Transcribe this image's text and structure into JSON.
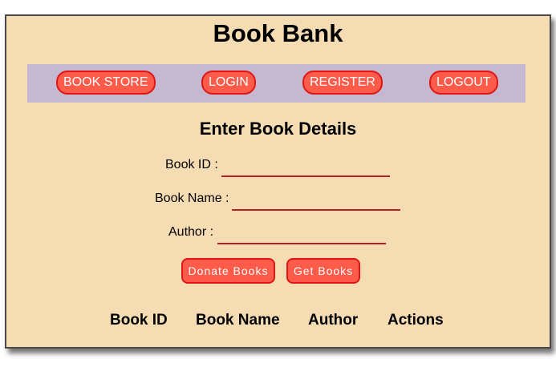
{
  "app": {
    "title": "Book Bank"
  },
  "nav": {
    "items": [
      {
        "label": "BOOK STORE"
      },
      {
        "label": "LOGIN"
      },
      {
        "label": "REGISTER"
      },
      {
        "label": "LOGOUT"
      }
    ]
  },
  "form": {
    "heading": "Enter Book Details",
    "fields": [
      {
        "label": "Book ID :",
        "value": ""
      },
      {
        "label": "Book Name :",
        "value": ""
      },
      {
        "label": "Author :",
        "value": ""
      }
    ],
    "donate_label": "Donate Books",
    "get_label": "Get Books"
  },
  "table": {
    "headers": [
      "Book ID",
      "Book Name",
      "Author",
      "Actions"
    ]
  },
  "colors": {
    "background": "#f5dcb3",
    "navbar": "#c5b8d1",
    "button": "#ff5b4a",
    "button_border": "#e01515",
    "input_underline": "#b22222"
  }
}
